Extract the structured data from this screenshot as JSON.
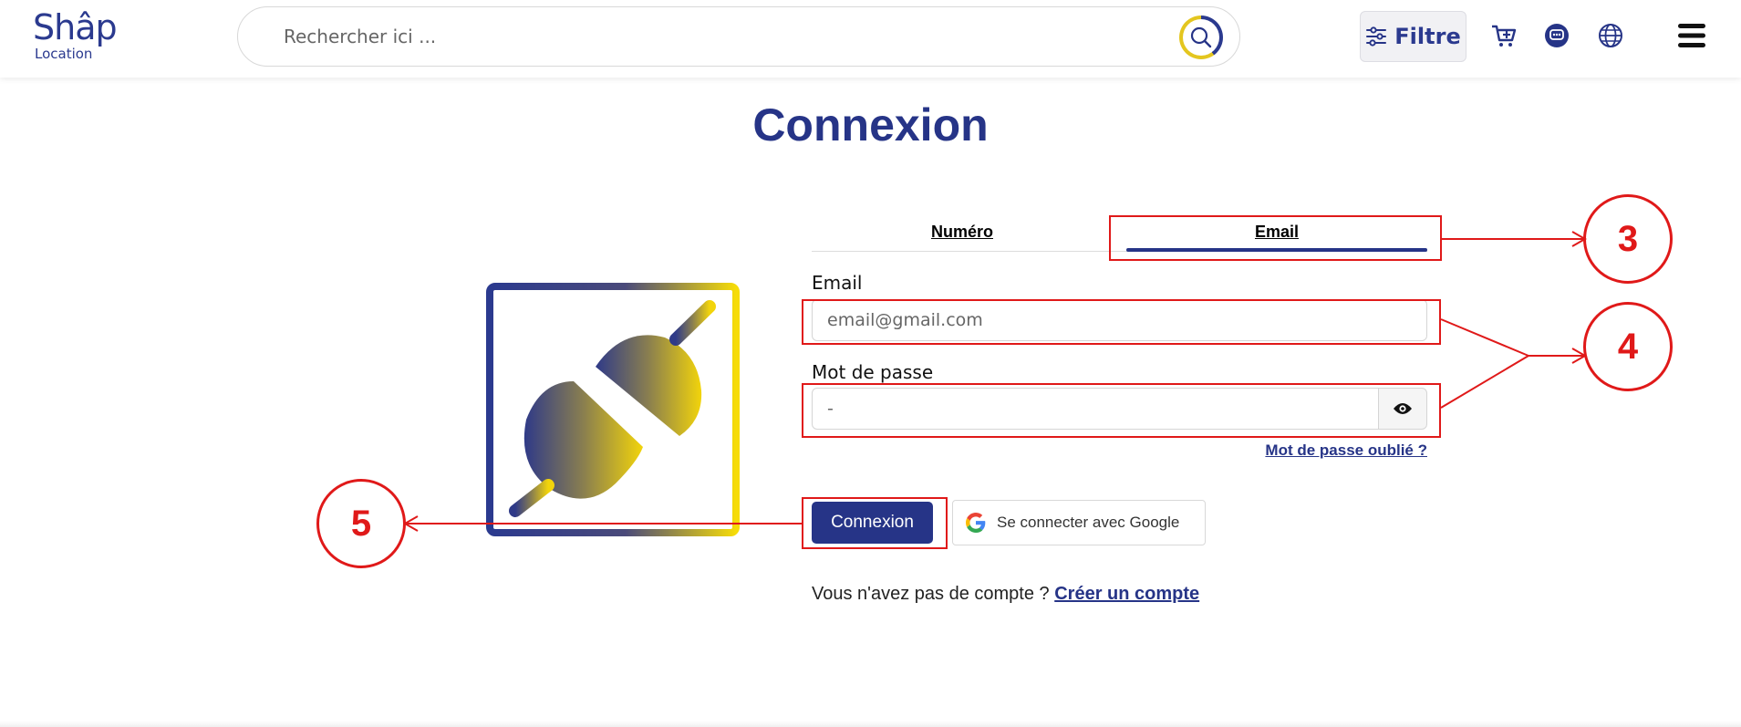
{
  "header": {
    "logo_main": "Shâp",
    "logo_sub": "Location",
    "search_placeholder": "Rechercher ici ...",
    "filter_label": "Filtre",
    "icons": [
      "sliders-icon",
      "cart-add-icon",
      "chat-icon",
      "globe-icon",
      "hamburger-menu-icon"
    ]
  },
  "page": {
    "title": "Connexion"
  },
  "tabs": [
    {
      "label": "Numéro",
      "active": false
    },
    {
      "label": "Email",
      "active": true
    }
  ],
  "form": {
    "email_label": "Email",
    "email_placeholder": "email@gmail.com",
    "password_label": "Mot de passe",
    "password_placeholder": "-",
    "forgot_label": "Mot de passe oublié ?",
    "login_button": "Connexion",
    "google_button": "Se connecter avec Google",
    "signup_text": "Vous n'avez pas de compte ?",
    "signup_link": "Créer un compte"
  },
  "annotations": [
    {
      "label": "3"
    },
    {
      "label": "4"
    },
    {
      "label": "5"
    }
  ],
  "colors": {
    "brand_blue": "#263487",
    "brand_yellow": "#f2d40b",
    "annotation_red": "#e01919"
  }
}
